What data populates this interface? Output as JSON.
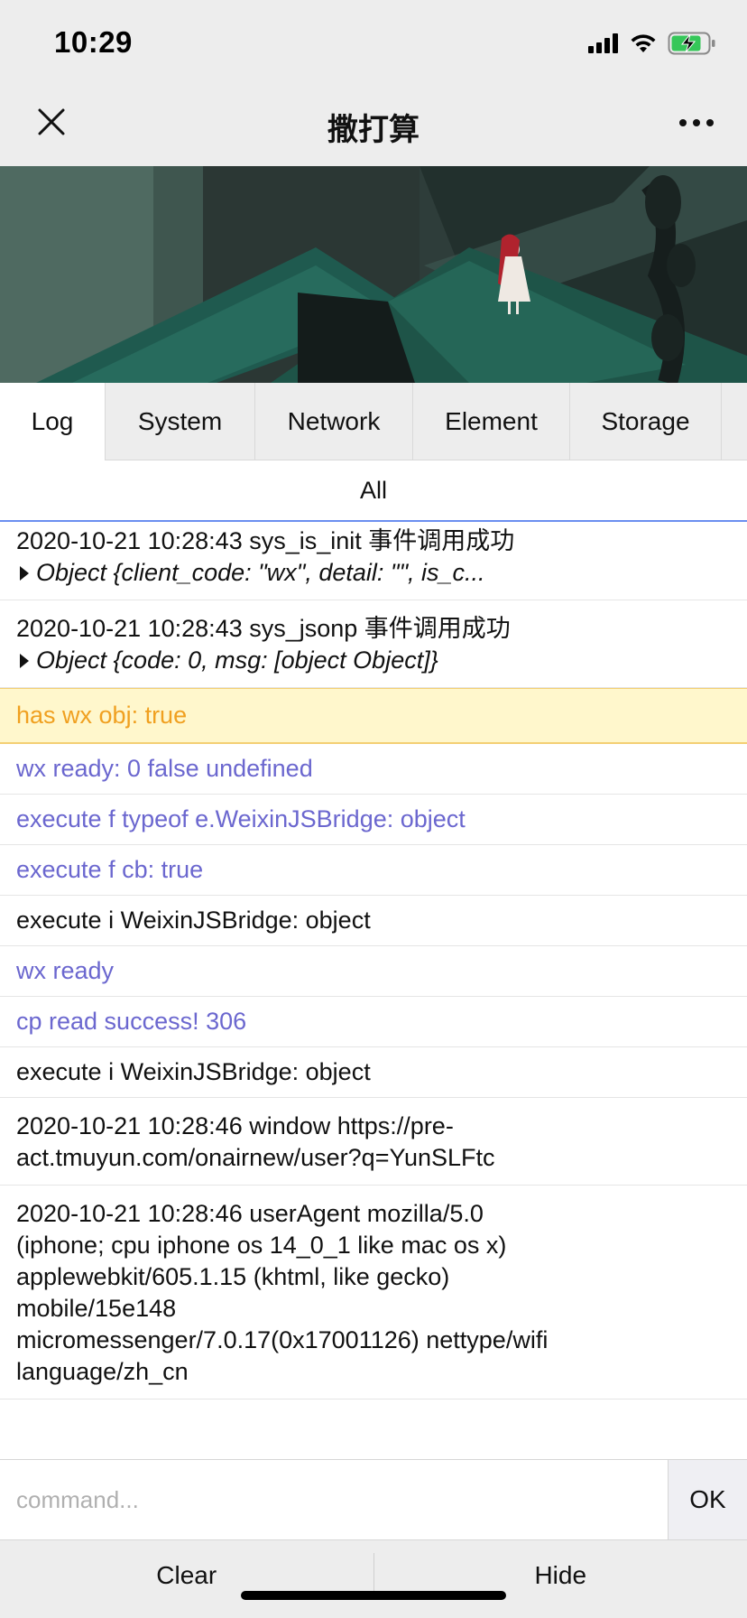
{
  "status_bar": {
    "time": "10:29",
    "icons": [
      "signal-icon",
      "wifi-icon",
      "battery-charging-icon"
    ]
  },
  "nav": {
    "title": "撒打算",
    "close_icon": "close-icon",
    "more_icon": "more-icon"
  },
  "tabs": [
    {
      "label": "Log",
      "active": true
    },
    {
      "label": "System",
      "active": false
    },
    {
      "label": "Network",
      "active": false
    },
    {
      "label": "Element",
      "active": false
    },
    {
      "label": "Storage",
      "active": false
    }
  ],
  "subtab": {
    "label": "All"
  },
  "logs": [
    {
      "type": "plain",
      "text": "2020-10-21 10:28:43 sys_is_init 事件调用成功",
      "object": "Object {client_code: \"wx\", detail: \"\", is_c..."
    },
    {
      "type": "plain",
      "text": "2020-10-21 10:28:43 sys_jsonp 事件调用成功",
      "object": "Object {code: 0, msg: [object Object]}"
    },
    {
      "type": "warn",
      "text": "has wx obj: true"
    },
    {
      "type": "info",
      "text": "wx ready: 0 false undefined"
    },
    {
      "type": "info",
      "text": "execute f typeof e.WeixinJSBridge: object"
    },
    {
      "type": "info",
      "text": "execute f cb: true"
    },
    {
      "type": "plain",
      "text": "execute i WeixinJSBridge: object"
    },
    {
      "type": "info",
      "text": "wx ready"
    },
    {
      "type": "info",
      "text": "cp read success! 306"
    },
    {
      "type": "plain",
      "text": "execute i WeixinJSBridge: object"
    },
    {
      "type": "plain",
      "lines": [
        "2020-10-21 10:28:46 window https://pre-",
        "act.tmuyun.com/onairnew/user?q=YunSLFtc"
      ]
    },
    {
      "type": "plain",
      "lines": [
        "2020-10-21 10:28:46 userAgent mozilla/5.0",
        "(iphone; cpu iphone os 14_0_1 like mac os x)",
        "applewebkit/605.1.15 (khtml, like gecko)",
        "mobile/15e148",
        "micromessenger/7.0.17(0x17001126) nettype/wifi",
        "language/zh_cn"
      ]
    }
  ],
  "command": {
    "placeholder": "command...",
    "value": "",
    "ok_label": "OK"
  },
  "bottom": {
    "clear_label": "Clear",
    "hide_label": "Hide"
  },
  "colors": {
    "info": "#6b67cf",
    "warn_text": "#f0a020",
    "warn_bg": "#fff7cc",
    "tab_active_border": "#6b8ff0"
  }
}
